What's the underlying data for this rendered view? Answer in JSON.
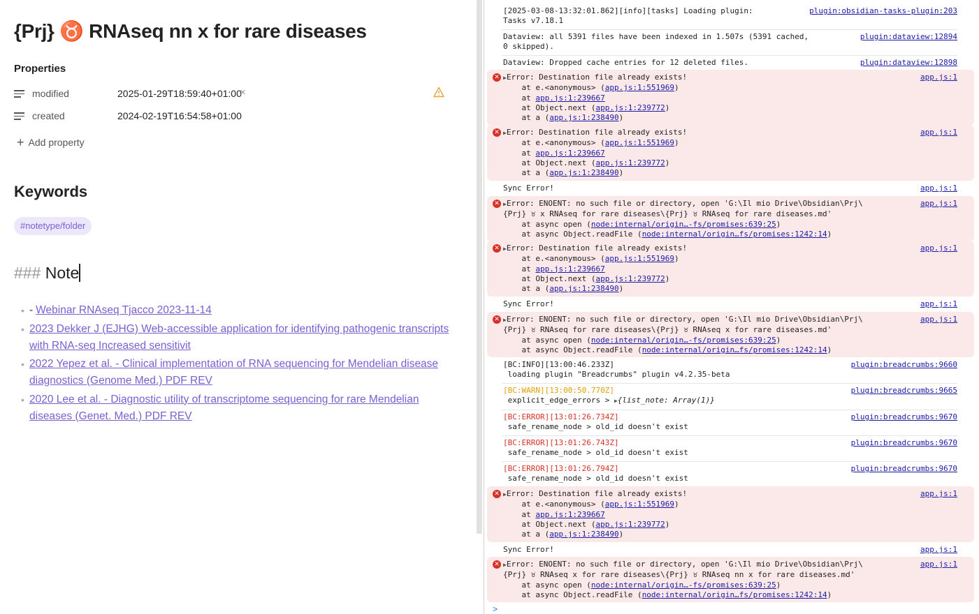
{
  "editor": {
    "title": "{Prj} ♉ RNAseq nn x for rare diseases",
    "properties_heading": "Properties",
    "properties": [
      {
        "key": "modified",
        "value": "2025-01-29T18:59:40+01:00"
      },
      {
        "key": "created",
        "value": "2024-02-19T16:54:58+01:00"
      }
    ],
    "add_property": "Add property",
    "keywords_heading": "Keywords",
    "tag": "#notetype/folder",
    "note_heading_hash": "###",
    "note_heading": "Note",
    "links": [
      {
        "prefix": "-",
        "text": "Webinar RNAseq Tjacco 2023-11-14"
      },
      {
        "prefix": "",
        "text": "2023 Dekker J (EJHG) Web-accessible application for identifying pathogenic transcripts with RNA-seq Increased sensitivit"
      },
      {
        "prefix": "",
        "text": "2022 Yepez et al. - Clinical implementation of RNA sequencing for Mendelian disease diagnostics (Genome Med.) PDF REV"
      },
      {
        "prefix": "",
        "text": "2020 Lee et al. - Diagnostic utility of transcriptome sequencing for rare Mendelian diseases (Genet. Med.) PDF REV"
      }
    ]
  },
  "console": {
    "entries": [
      {
        "id": "e1",
        "type": "log",
        "lines": [
          "[2025-03-08-13:32:01.862][info][tasks] Loading plugin:",
          "Tasks v7.18.1"
        ],
        "source": "plugin:obsidian-tasks-plugin:203"
      },
      {
        "id": "e2",
        "type": "log",
        "lines": [
          "Dataview: all 5391 files have been indexed in 1.507s (5391 cached,",
          "0 skipped)."
        ],
        "source": "plugin:dataview:12894"
      },
      {
        "id": "e3",
        "type": "log",
        "lines": [
          "Dataview: Dropped cache entries for 12 deleted files."
        ],
        "source": "plugin:dataview:12898"
      },
      {
        "id": "e4",
        "type": "error",
        "lines": [
          "▶Error: Destination file already exists!",
          "    at e.<anonymous> (app.js:1:551969)",
          "    at app.js:1:239667",
          "    at Object.next (app.js:1:239772)",
          "    at a (app.js:1:238490)"
        ],
        "source": "app.js:1"
      },
      {
        "id": "e5",
        "type": "error",
        "lines": [
          "▶Error: Destination file already exists!",
          "    at e.<anonymous> (app.js:1:551969)",
          "    at app.js:1:239667",
          "    at Object.next (app.js:1:239772)",
          "    at a (app.js:1:238490)"
        ],
        "source": "app.js:1"
      },
      {
        "id": "e6",
        "type": "log",
        "lines": [
          "Sync Error!"
        ],
        "source": "app.js:1"
      },
      {
        "id": "e7",
        "type": "error",
        "lines": [
          "▶Error: ENOENT: no such file or directory, open 'G:\\Il mio Drive\\Obsidian\\Prj\\",
          "{Prj} ♉ x RNAseq for rare diseases\\{Prj} ♉ RNAseq for rare diseases.md'",
          "    at async open (node:internal/origin…-fs/promises:639:25)",
          "    at async Object.readFile (node:internal/origin…fs/promises:1242:14)"
        ],
        "source": "app.js:1"
      },
      {
        "id": "e8",
        "type": "error",
        "lines": [
          "▶Error: Destination file already exists!",
          "    at e.<anonymous> (app.js:1:551969)",
          "    at app.js:1:239667",
          "    at Object.next (app.js:1:239772)",
          "    at a (app.js:1:238490)"
        ],
        "source": "app.js:1"
      },
      {
        "id": "e9",
        "type": "log",
        "lines": [
          "Sync Error!"
        ],
        "source": "app.js:1"
      },
      {
        "id": "e10",
        "type": "error",
        "lines": [
          "▶Error: ENOENT: no such file or directory, open 'G:\\Il mio Drive\\Obsidian\\Prj\\",
          "{Prj} ♉ RNAseq for rare diseases\\{Prj} ♉ RNAseq x for rare diseases.md'",
          "    at async open (node:internal/origin…-fs/promises:639:25)",
          "    at async Object.readFile (node:internal/origin…fs/promises:1242:14)"
        ],
        "source": "app.js:1"
      },
      {
        "id": "e11",
        "type": "log",
        "lines": [
          "[BC:INFO][13:00:46.233Z]",
          " loading plugin \"Breadcrumbs\" plugin v4.2.35-beta"
        ],
        "source": "plugin:breadcrumbs:9660"
      },
      {
        "id": "e12",
        "type": "warn",
        "lines": [
          "[BC:WARN][13:00:50.770Z]",
          " explicit_edge_errors > ▶{list_note: Array(1)}"
        ],
        "source": "plugin:breadcrumbs:9665"
      },
      {
        "id": "e13",
        "type": "bcerror",
        "lines": [
          "[BC:ERROR][13:01:26.734Z]",
          " safe_rename_node > old_id doesn't exist"
        ],
        "source": "plugin:breadcrumbs:9670"
      },
      {
        "id": "e14",
        "type": "bcerror",
        "lines": [
          "[BC:ERROR][13:01:26.743Z]",
          " safe_rename_node > old_id doesn't exist"
        ],
        "source": "plugin:breadcrumbs:9670"
      },
      {
        "id": "e15",
        "type": "bcerror",
        "lines": [
          "[BC:ERROR][13:01:26.794Z]",
          " safe_rename_node > old_id doesn't exist"
        ],
        "source": "plugin:breadcrumbs:9670"
      },
      {
        "id": "e16",
        "type": "error",
        "lines": [
          "▶Error: Destination file already exists!",
          "    at e.<anonymous> (app.js:1:551969)",
          "    at app.js:1:239667",
          "    at Object.next (app.js:1:239772)",
          "    at a (app.js:1:238490)"
        ],
        "source": "app.js:1"
      },
      {
        "id": "e17",
        "type": "log",
        "lines": [
          "Sync Error!"
        ],
        "source": "app.js:1"
      },
      {
        "id": "e18",
        "type": "error",
        "lines": [
          "▶Error: ENOENT: no such file or directory, open 'G:\\Il mio Drive\\Obsidian\\Prj\\",
          "{Prj} ♉ RNAseq x for rare diseases\\{Prj} ♉ RNAseq nn x for rare diseases.md'",
          "    at async open (node:internal/origin…-fs/promises:639:25)",
          "    at async Object.readFile (node:internal/origin…fs/promises:1242:14)"
        ],
        "source": "app.js:1"
      }
    ],
    "prompt_symbol": ">",
    "colors": {
      "error_bg": "#fbe9e9",
      "error_icon": "#d93025",
      "link": "#1a1aa6",
      "warn": "#e0a000",
      "tag_bg": "#ece7fa",
      "accent": "#7a5fd0"
    }
  }
}
